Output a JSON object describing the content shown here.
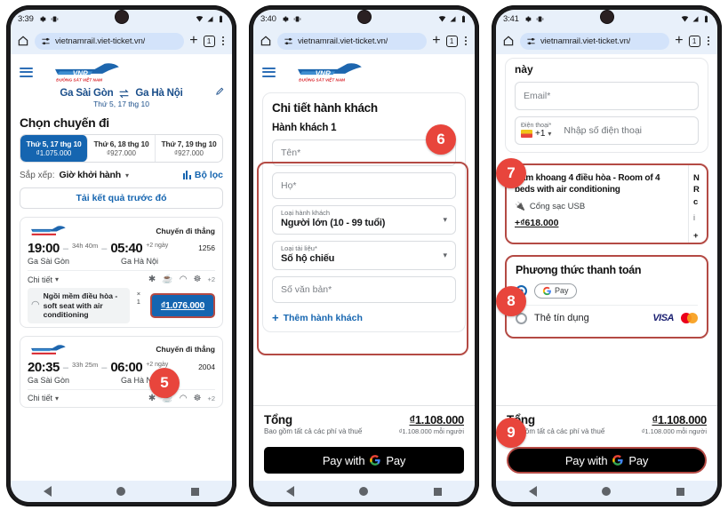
{
  "phones": [
    {
      "id": "phone-1",
      "status": {
        "time": "3:39",
        "icons": [
          "gear-icon",
          "vibrate-icon",
          "wifi-icon",
          "signal-icon",
          "battery-icon"
        ]
      },
      "browser": {
        "url": "vietnamrail.viet-ticket.vn/",
        "tab_count": "1",
        "new_tab_label": "+"
      },
      "site": {
        "logo_text": "VNR",
        "logo_subtext": "ĐƯỜNG SẮT VIỆT NAM",
        "origin": "Ga Sài Gòn",
        "destination": "Ga Hà Nội",
        "date": "Thứ 5, 17 thg 10"
      },
      "page_title": "Chọn chuyến đi",
      "date_tabs": [
        {
          "day": "Thứ 5, 17 thg 10",
          "price": "₫1.075.000",
          "active": true
        },
        {
          "day": "Thứ 6, 18 thg 10",
          "price": "₫927.000",
          "active": false
        },
        {
          "day": "Thứ 7, 19 thg 10",
          "price": "₫927.000",
          "active": false
        }
      ],
      "sort": {
        "label": "Sắp xếp:",
        "value": "Giờ khởi hành",
        "filter_label": "Bộ lọc"
      },
      "load_previous": "Tải kết quả trước đó",
      "trips": [
        {
          "direct_label": "Chuyến đi thẳng",
          "depart_time": "19:00",
          "duration": "34h 40m",
          "arrive_time": "05:40",
          "plus_days": "+2 ngày",
          "train_no": "1256",
          "origin": "Ga Sài Gòn",
          "destination": "Ga Hà Nội",
          "detail_label": "Chi tiết",
          "amenities_more": "+2",
          "seat_name": "Ngồi mềm điều hòa - soft seat with air conditioning",
          "seat_qty": "× 1",
          "price": "₫1.076.000"
        },
        {
          "direct_label": "Chuyến đi thẳng",
          "depart_time": "20:35",
          "duration": "33h 25m",
          "arrive_time": "06:00",
          "plus_days": "+2 ngày",
          "train_no": "2004",
          "origin": "Ga Sài Gòn",
          "destination": "Ga Hà Nội",
          "detail_label": "Chi tiết",
          "amenities_more": "+2"
        }
      ],
      "badges": [
        {
          "number": "5"
        }
      ]
    },
    {
      "id": "phone-2",
      "status": {
        "time": "3:40"
      },
      "browser": {
        "url": "vietnamrail.viet-ticket.vn/",
        "tab_count": "1",
        "new_tab_label": "+"
      },
      "site": {
        "logo_text": "VNR",
        "logo_subtext": "ĐƯỜNG SẮT VIỆT NAM"
      },
      "form": {
        "title": "Chi tiết hành khách",
        "subtitle": "Hành khách 1",
        "first_name_placeholder": "Tên*",
        "last_name_placeholder": "Họ*",
        "pax_type_label": "Loại hành khách",
        "pax_type_value": "Người lớn (10 - 99 tuổi)",
        "doc_type_label": "Loại tài liệu*",
        "doc_type_value": "Số hộ chiếu",
        "doc_number_placeholder": "Số văn bản*",
        "add_passenger": "Thêm hành khách"
      },
      "total": {
        "label": "Tổng",
        "amount": "₫1.108.000",
        "note": "Bao gồm tất cả các phí và thuế",
        "per_person": "₫1.108.000 mỗi người"
      },
      "pay_button": {
        "prefix": "Pay with",
        "brand": "Pay"
      },
      "badges": [
        {
          "number": "6"
        }
      ]
    },
    {
      "id": "phone-3",
      "status": {
        "time": "3:41"
      },
      "browser": {
        "url": "vietnamrail.viet-ticket.vn/",
        "tab_count": "1",
        "new_tab_label": "+"
      },
      "contact": {
        "trailing_text": "này",
        "email_placeholder": "Email*",
        "phone_label": "Điện thoại*",
        "country_code": "+1",
        "phone_placeholder": "Nhập số điện thoại"
      },
      "option": {
        "name": "Nằm khoang 4 điều hòa - Room of 4 beds with air conditioning",
        "amenity": "Cổng sạc USB",
        "price": "+₫618.000",
        "peek": [
          "N",
          "R",
          "c"
        ],
        "peek_amenity": "i",
        "peek_price": "+"
      },
      "payment": {
        "title": "Phương thức thanh toán",
        "options": [
          {
            "label": "G Pay",
            "type": "gpay",
            "selected": true
          },
          {
            "label": "Thẻ tín dụng",
            "type": "card",
            "selected": false,
            "logos": [
              "visa",
              "mastercard"
            ]
          }
        ]
      },
      "total": {
        "label": "Tổng",
        "amount": "₫1.108.000",
        "note": "Bao gồm tất cả các phí và thuế",
        "per_person": "₫1.108.000 mỗi người"
      },
      "pay_button": {
        "prefix": "Pay with",
        "brand": "Pay"
      },
      "badges": [
        {
          "number": "7"
        },
        {
          "number": "8"
        },
        {
          "number": "9"
        }
      ]
    }
  ],
  "colors": {
    "accent_blue": "#1565b0",
    "badge_red": "#e8453c",
    "highlight_ring": "#b44a44",
    "chrome_bg": "#e8f0fa"
  }
}
